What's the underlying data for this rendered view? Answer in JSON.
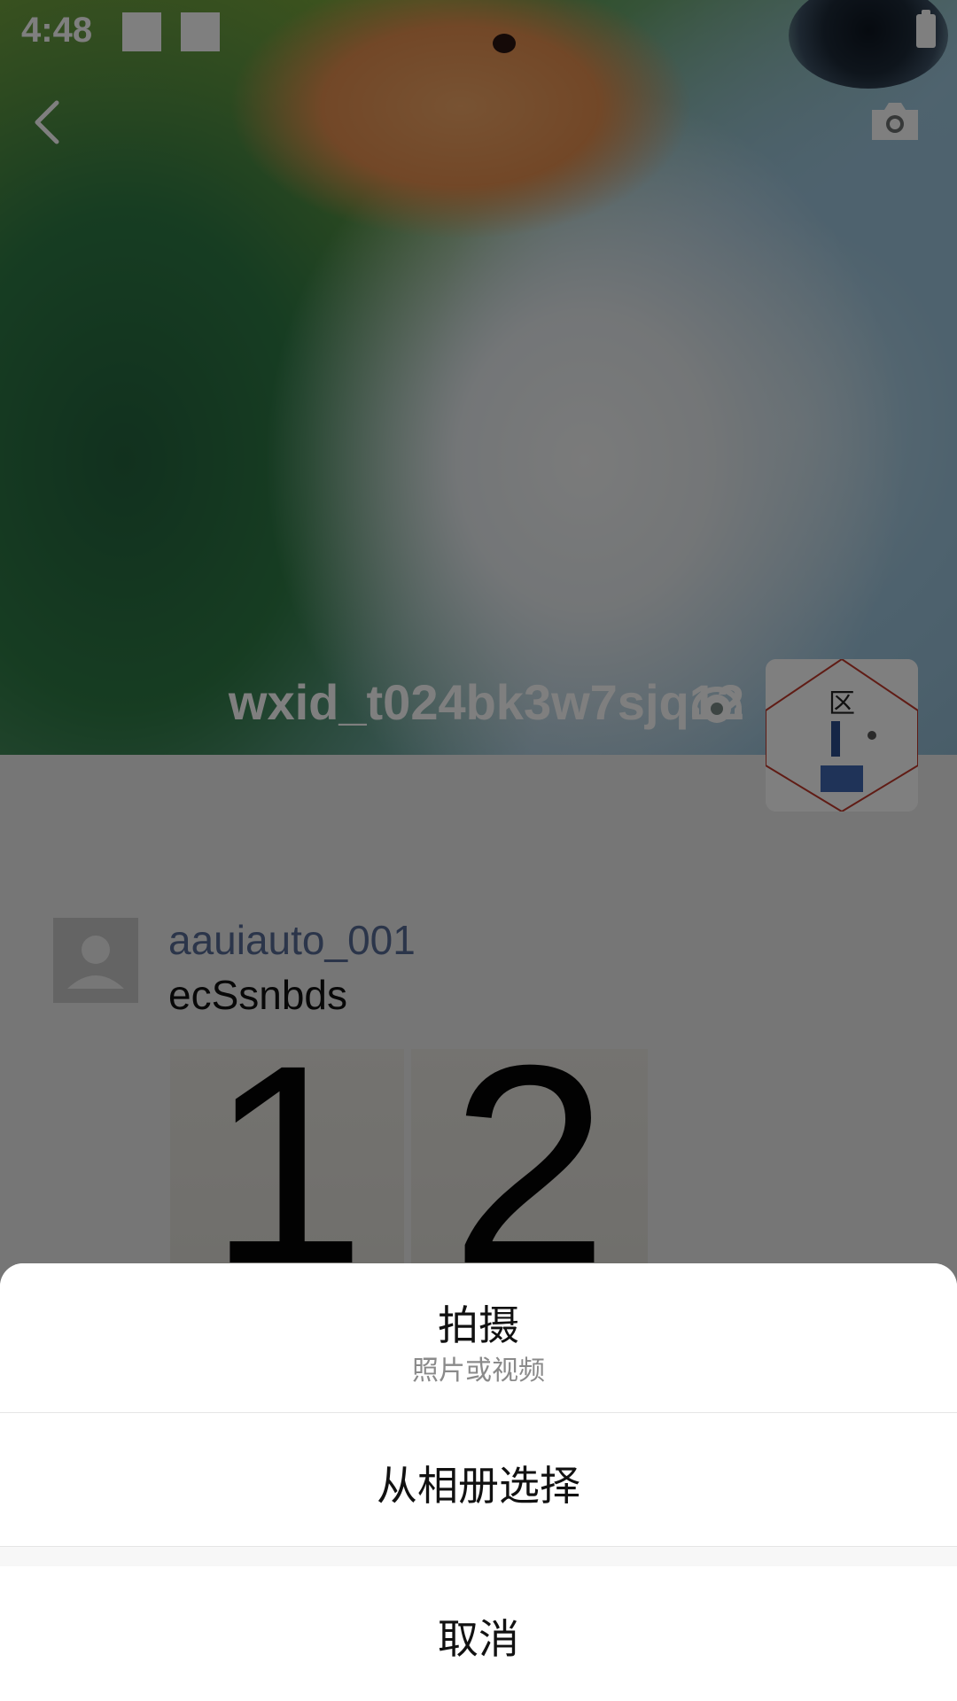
{
  "status_bar": {
    "time": "4:48"
  },
  "profile": {
    "username": "wxid_t024bk3w7sjq12"
  },
  "post": {
    "author": "aauiauto_001",
    "text": "ecSsnbds",
    "photos": [
      "1",
      "2"
    ]
  },
  "action_sheet": {
    "shoot_label": "拍摄",
    "shoot_sub": "照片或视频",
    "album_label": "从相册选择",
    "cancel_label": "取消"
  },
  "colors": {
    "link_blue": "#576b95",
    "overlay": "rgba(0,0,0,0.5)",
    "sheet_bg": "#ffffff"
  },
  "icons": {
    "back": "back-chevron-icon",
    "camera": "camera-icon",
    "status": "status-icon",
    "avatar_placeholder": "person-icon"
  }
}
